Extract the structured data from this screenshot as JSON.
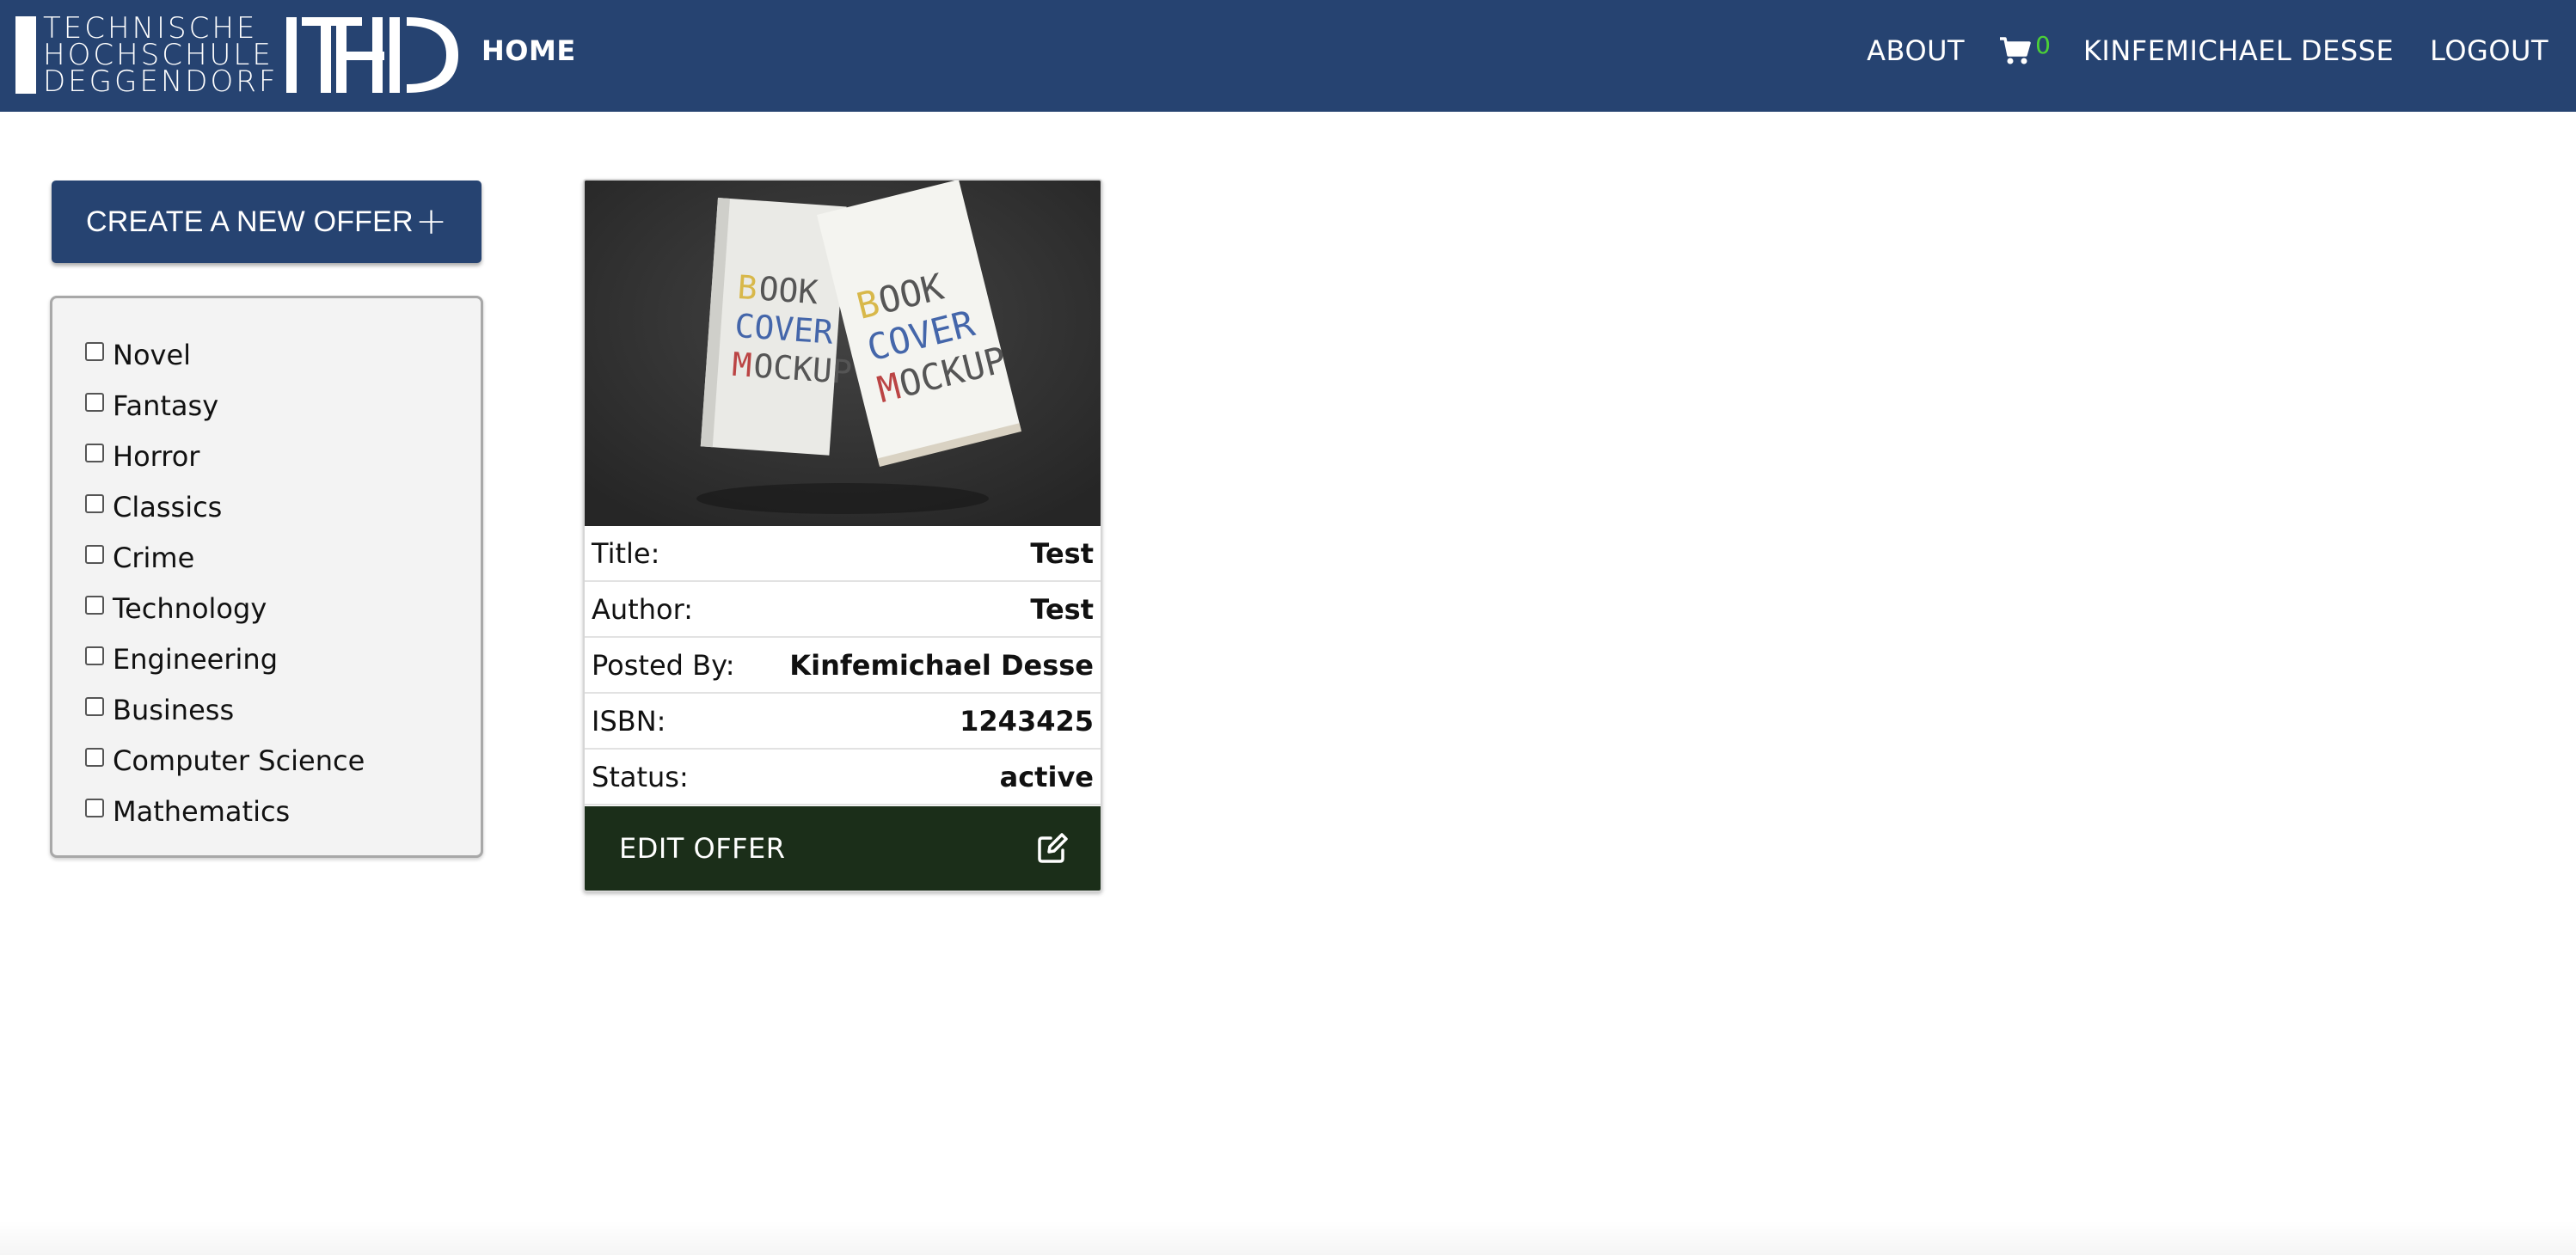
{
  "navbar": {
    "logo_lines": [
      "TECHNISCHE",
      "HOCHSCHULE",
      "DEGGENDORF"
    ],
    "home_label": "HOME",
    "about_label": "ABOUT",
    "cart_count": "0",
    "user_label": "KINFEMICHAEL DESSE",
    "logout_label": "LOGOUT"
  },
  "create_button": {
    "label": "CREATE A NEW OFFER"
  },
  "filters": {
    "items": [
      {
        "label": "Novel",
        "checked": false
      },
      {
        "label": "Fantasy",
        "checked": false
      },
      {
        "label": "Horror",
        "checked": false
      },
      {
        "label": "Classics",
        "checked": false
      },
      {
        "label": "Crime",
        "checked": false
      },
      {
        "label": "Technology",
        "checked": false
      },
      {
        "label": "Engineering",
        "checked": false
      },
      {
        "label": "Business",
        "checked": false
      },
      {
        "label": "Computer Science",
        "checked": false
      },
      {
        "label": "Mathematics",
        "checked": false
      }
    ]
  },
  "offer_card": {
    "image_text": [
      "BOOK",
      "COVER",
      "MOCKUP"
    ],
    "rows": [
      {
        "label": "Title:",
        "value": "Test"
      },
      {
        "label": "Author:",
        "value": "Test"
      },
      {
        "label": "Posted By:",
        "value": "Kinfemichael Desse"
      },
      {
        "label": "ISBN:",
        "value": "1243425"
      },
      {
        "label": "Status:",
        "value": "active"
      }
    ],
    "edit_label": "EDIT OFFER"
  },
  "colors": {
    "navbar": "#264371",
    "create_button": "#264371",
    "edit_button": "#1b2e19",
    "cart_count": "#4cd137"
  }
}
